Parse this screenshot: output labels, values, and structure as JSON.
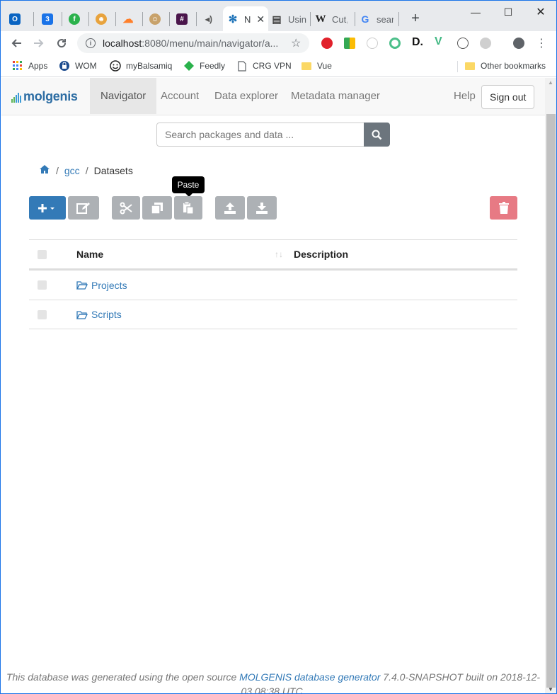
{
  "browser": {
    "tabs": [
      {
        "icon": "outlook-icon",
        "color": "#0a64c2",
        "glyph": "O"
      },
      {
        "icon": "calendar-icon",
        "color": "#1a73e8",
        "glyph": "3"
      },
      {
        "icon": "feedly-icon",
        "color": "#2bb24c",
        "glyph": "f"
      },
      {
        "icon": "worker-icon",
        "color": "#e8a33d",
        "glyph": "☻"
      },
      {
        "icon": "cloud-icon",
        "color": "#ff7f2a",
        "glyph": "☁"
      },
      {
        "icon": "jenkins-icon",
        "color": "#c8a26b",
        "glyph": "☺"
      },
      {
        "icon": "slack-icon",
        "color": "#4a154b",
        "glyph": "#"
      },
      {
        "icon": "speaker-icon",
        "color": "#555555",
        "glyph": "◂"
      },
      {
        "icon": "molgenis-icon",
        "color": "#1f74b9",
        "glyph": "✻",
        "title": "N",
        "active": true
      },
      {
        "icon": "book-icon",
        "color": "#444444",
        "glyph": "▤",
        "title": "Usin"
      },
      {
        "icon": "wikipedia-icon",
        "color": "#222222",
        "glyph": "W",
        "title": "Cut,"
      },
      {
        "icon": "google-icon",
        "color": "#4285f4",
        "glyph": "G",
        "title": "sear"
      }
    ],
    "url_host": "localhost",
    "url_path": ":8080/menu/main/navigator/a...",
    "bookmarks": [
      {
        "label": "Apps"
      },
      {
        "label": "WOM"
      },
      {
        "label": "myBalsamiq"
      },
      {
        "label": "Feedly"
      },
      {
        "label": "CRG VPN"
      },
      {
        "label": "Vue"
      }
    ],
    "other_bookmarks": "Other bookmarks"
  },
  "navbar": {
    "logo": "molgenis",
    "links": [
      "Navigator",
      "Account",
      "Data explorer",
      "Metadata manager"
    ],
    "help": "Help",
    "signout": "Sign out"
  },
  "search": {
    "placeholder": "Search packages and data ..."
  },
  "breadcrumb": {
    "items": [
      "gcc",
      "Datasets"
    ]
  },
  "toolbar": {
    "tooltip": "Paste"
  },
  "table": {
    "headers": {
      "name": "Name",
      "description": "Description"
    },
    "rows": [
      {
        "name": "Projects",
        "description": ""
      },
      {
        "name": "Scripts",
        "description": ""
      }
    ]
  },
  "footer": {
    "prefix": "This database was generated using the open source ",
    "link": "MOLGENIS database generator",
    "suffix": " 7.4.0-SNAPSHOT built on 2018-12-03 08:38 UTC."
  },
  "colors": {
    "primary": "#337ab7",
    "disabled": "#adb1b5",
    "danger": "#e77a84"
  }
}
